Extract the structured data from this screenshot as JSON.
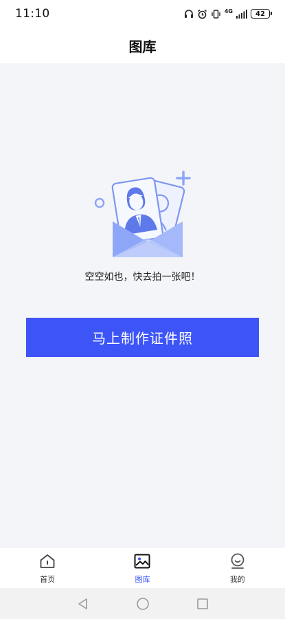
{
  "status_bar": {
    "time": "11:10",
    "network": "4G",
    "battery": "42",
    "icons": [
      "headphones-icon",
      "alarm-icon",
      "vibrate-icon",
      "signal-icon",
      "battery-icon"
    ]
  },
  "header": {
    "title": "图库"
  },
  "main": {
    "empty_message": "空空如也，快去拍一张吧！",
    "illustration": "empty-envelope-with-photos",
    "cta_label": "马上制作证件照"
  },
  "tab_bar": {
    "tabs": [
      {
        "label": "首页",
        "icon": "home-icon",
        "active": false
      },
      {
        "label": "图库",
        "icon": "gallery-icon",
        "active": true
      },
      {
        "label": "我的",
        "icon": "profile-icon",
        "active": false
      }
    ]
  },
  "system_nav": {
    "buttons": [
      "back-icon",
      "home-circle-icon",
      "recents-icon"
    ]
  },
  "colors": {
    "accent": "#3d55f7",
    "main_bg": "#f4f5f9",
    "illustration_blue": "#8ea6f8"
  }
}
